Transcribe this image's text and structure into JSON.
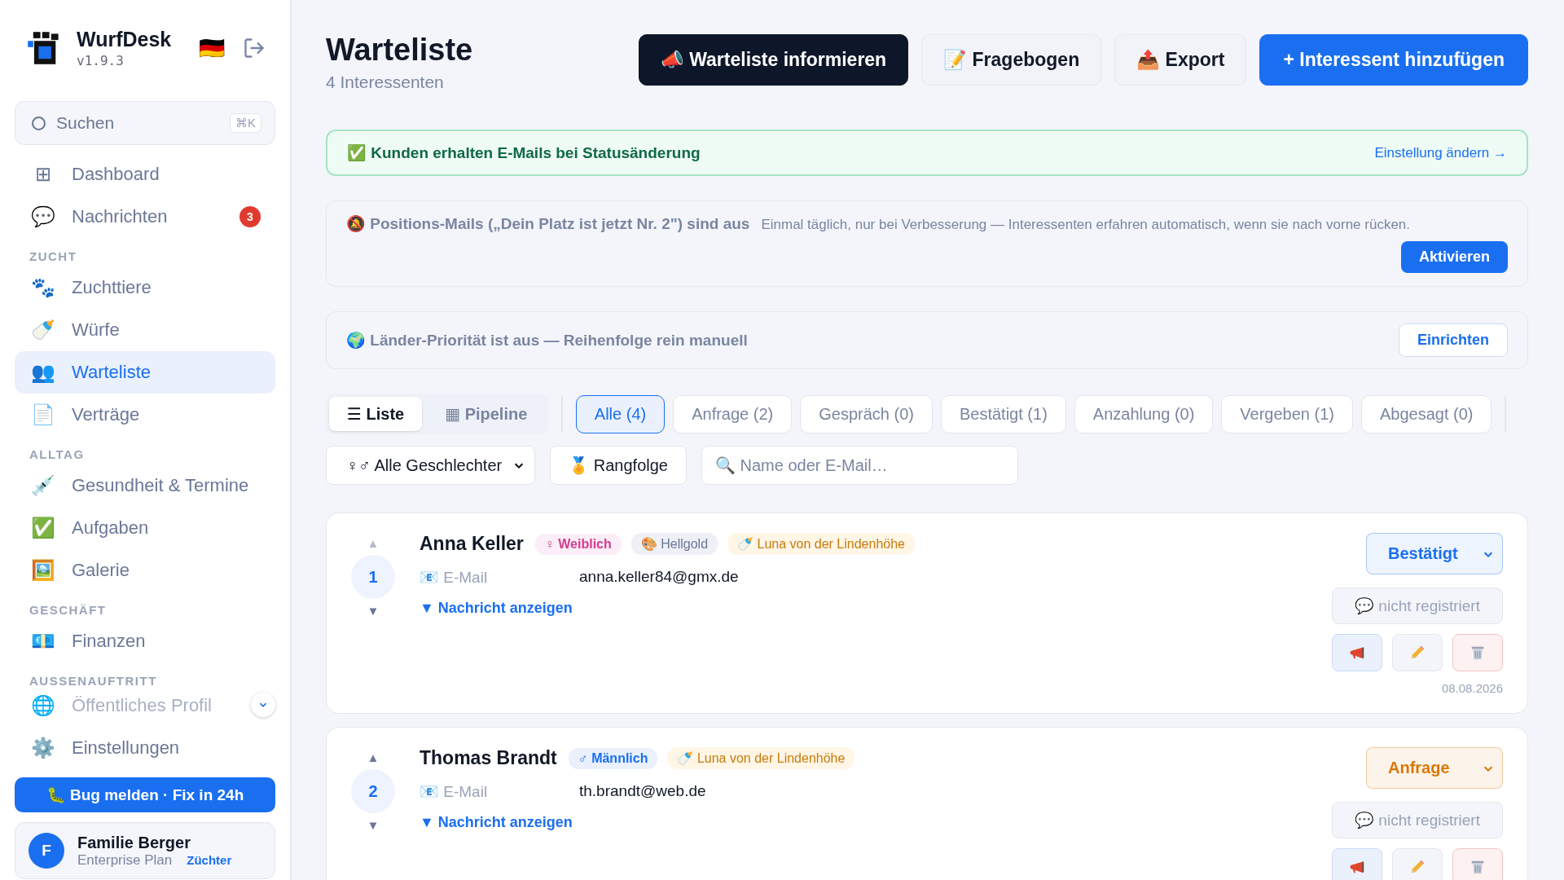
{
  "brand": {
    "name": "WurfDesk",
    "version": "v1.9.3",
    "flag": "🇩🇪"
  },
  "search": {
    "placeholder": "Suchen",
    "shortcut": "⌘K"
  },
  "nav": [
    {
      "kind": "item",
      "icon": "⊞",
      "label": "Dashboard",
      "selected": false
    },
    {
      "kind": "item",
      "icon": "💬",
      "label": "Nachrichten",
      "selected": false,
      "badge": "3"
    },
    {
      "kind": "section",
      "label": "ZUCHT"
    },
    {
      "kind": "item",
      "icon": "🐾",
      "label": "Zuchttiere",
      "selected": false
    },
    {
      "kind": "item",
      "icon": "🍼",
      "label": "Würfe",
      "selected": false
    },
    {
      "kind": "item",
      "icon": "👥",
      "label": "Warteliste",
      "selected": true
    },
    {
      "kind": "item",
      "icon": "📄",
      "label": "Verträge",
      "selected": false
    },
    {
      "kind": "section",
      "label": "ALLTAG"
    },
    {
      "kind": "item",
      "icon": "💉",
      "label": "Gesundheit & Termine",
      "selected": false
    },
    {
      "kind": "item",
      "icon": "✅",
      "label": "Aufgaben",
      "selected": false
    },
    {
      "kind": "item",
      "icon": "🖼️",
      "label": "Galerie",
      "selected": false
    },
    {
      "kind": "section",
      "label": "GESCHÄFT"
    },
    {
      "kind": "item",
      "icon": "💶",
      "label": "Finanzen",
      "selected": false
    },
    {
      "kind": "section",
      "label": "AUSSENAUFTRITT"
    },
    {
      "kind": "faded",
      "icon": "🌐",
      "label": "Öffentliches Profil"
    }
  ],
  "settings": {
    "icon": "⚙️",
    "label": "Einstellungen"
  },
  "bug_button": "🐛 Bug melden · Fix in 24h",
  "account": {
    "initial": "F",
    "name": "Familie Berger",
    "plan": "Enterprise Plan",
    "role": "Züchter"
  },
  "page": {
    "title": "Warteliste",
    "subtitle": "4 Interessenten"
  },
  "actions": [
    {
      "kind": "dark",
      "label": "📣 Warteliste informieren"
    },
    {
      "kind": "light",
      "label": "📝 Fragebogen"
    },
    {
      "kind": "light",
      "label": "📤 Export"
    },
    {
      "kind": "primary",
      "label": "+ Interessent hinzufügen"
    }
  ],
  "notice": {
    "text": "✅ Kunden erhalten E-Mails bei Statusänderung",
    "link": "Einstellung ändern →"
  },
  "position_mails": {
    "title": "🔕 Positions-Mails („Dein Platz ist jetzt Nr. 2\") sind aus",
    "description": "Einmal täglich, nur bei Verbesserung — Interessenten erfahren automatisch, wenn sie nach vorne rücken.",
    "button": "Aktivieren"
  },
  "country_priority": {
    "title": "🌍 Länder-Priorität ist aus — Reihenfolge rein manuell",
    "button": "Einrichten"
  },
  "views": [
    {
      "label": "☰ Liste",
      "selected": true
    },
    {
      "label": "▦ Pipeline",
      "selected": false
    }
  ],
  "status_filters": [
    {
      "label": "Alle (4)",
      "selected": true
    },
    {
      "label": "Anfrage (2)",
      "selected": false
    },
    {
      "label": "Gespräch (0)",
      "selected": false
    },
    {
      "label": "Bestätigt (1)",
      "selected": false
    },
    {
      "label": "Anzahlung (0)",
      "selected": false
    },
    {
      "label": "Vergeben (1)",
      "selected": false
    },
    {
      "label": "Abgesagt (0)",
      "selected": false
    }
  ],
  "gender_filter": "♀♂ Alle Geschlechter",
  "sort_button": "🏅 Rangfolge",
  "name_search": {
    "placeholder": "🔍 Name oder E-Mail…"
  },
  "entries": [
    {
      "rank": "1",
      "up": "▲",
      "down": "▼",
      "up_disabled": true,
      "name": "Anna Keller",
      "tags": [
        {
          "kind": "female",
          "label": "♀ Weiblich"
        },
        {
          "kind": "color",
          "label": "🎨 Hellgold"
        },
        {
          "kind": "litter",
          "label": "🍼 Luna von der Lindenhöhe"
        }
      ],
      "email_label": "📧 E-Mail",
      "email": "anna.keller84@gmx.de",
      "toggle": "▼ Nachricht anzeigen",
      "status": {
        "label": "Bestätigt",
        "color": "#1a6ff0"
      },
      "chat": "💬 nicht registriert",
      "date": "08.08.2026"
    },
    {
      "rank": "2",
      "up": "▲",
      "down": "▼",
      "up_disabled": false,
      "name": "Thomas Brandt",
      "tags": [
        {
          "kind": "male",
          "label": "♂ Männlich"
        },
        {
          "kind": "litter",
          "label": "🍼 Luna von der Lindenhöhe"
        }
      ],
      "email_label": "📧 E-Mail",
      "email": "th.brandt@web.de",
      "toggle": "▼ Nachricht anzeigen",
      "status": {
        "label": "Anfrage",
        "color": "#d97706"
      },
      "chat": "💬 nicht registriert"
    }
  ]
}
